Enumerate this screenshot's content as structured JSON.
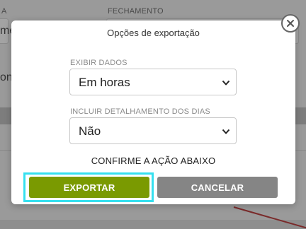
{
  "background": {
    "label_left": "A",
    "label_right": "FECHAMENTO",
    "field_text_1": "me",
    "field_text_2": "on"
  },
  "modal": {
    "title": "Opções de exportação",
    "close_icon": "close-icon",
    "fields": [
      {
        "label": "EXIBIR DADOS",
        "selected": "Em horas"
      },
      {
        "label": "INCLUIR DETALHAMENTO DOS DIAS",
        "selected": "Não"
      }
    ],
    "confirm_text": "CONFIRME A AÇÃO ABAIXO",
    "export_label": "EXPORTAR",
    "cancel_label": "CANCELAR"
  },
  "colors": {
    "export_button": "#7a9a01",
    "cancel_button": "#858585",
    "focus_ring": "#35e0ef"
  }
}
